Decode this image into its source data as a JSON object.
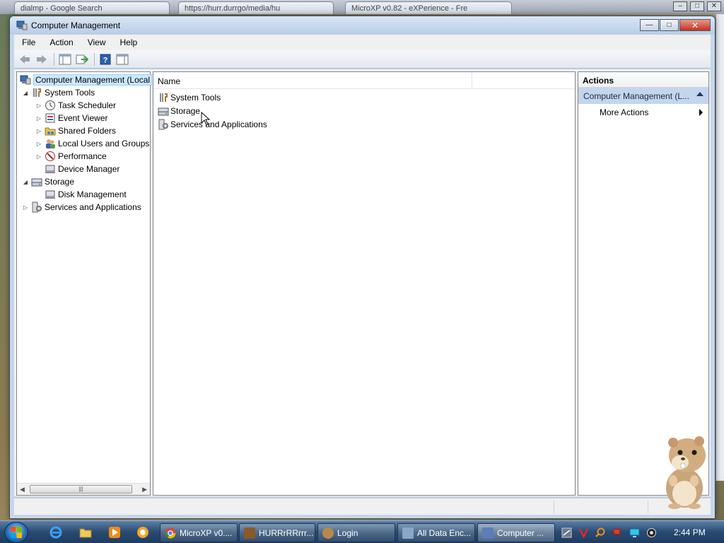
{
  "background": {
    "tabs": [
      "dialmp - Google Search",
      "https://hurr.durrgo/media/hu",
      "MicroXP v0.82 - eXPerience - Fre"
    ]
  },
  "window": {
    "title": "Computer Management",
    "controls": {
      "minimize": "—",
      "maximize": "□",
      "close": "✕"
    }
  },
  "menu": [
    "File",
    "Action",
    "View",
    "Help"
  ],
  "toolbar": {
    "buttons": [
      "back-icon",
      "forward-icon",
      "show-hide-tree-icon",
      "export-list-icon",
      "help-icon",
      "show-hide-action-pane-icon"
    ]
  },
  "tree": {
    "root": "Computer Management (Local",
    "system_tools": "System Tools",
    "task_scheduler": "Task Scheduler",
    "event_viewer": "Event Viewer",
    "shared_folders": "Shared Folders",
    "local_users": "Local Users and Groups",
    "performance": "Performance",
    "device_manager": "Device Manager",
    "storage": "Storage",
    "disk_management": "Disk Management",
    "services": "Services and Applications"
  },
  "list": {
    "column_name": "Name",
    "items": [
      "System Tools",
      "Storage",
      "Services and Applications"
    ]
  },
  "actions": {
    "header": "Actions",
    "section": "Computer Management (L...",
    "more_actions": "More Actions"
  },
  "taskbar": {
    "items": [
      {
        "label": "MicroXP v0....",
        "icon_color": "#d9452e"
      },
      {
        "label": "HURRrRRrrr...",
        "icon_color": "#8a5a2b"
      },
      {
        "label": "Login",
        "icon_color": "#b88a4a"
      },
      {
        "label": "All Data Enc...",
        "icon_color": "#8aa6c8"
      },
      {
        "label": "Computer ...",
        "icon_color": "#5b7db8"
      }
    ],
    "clock": "2:44 PM"
  }
}
